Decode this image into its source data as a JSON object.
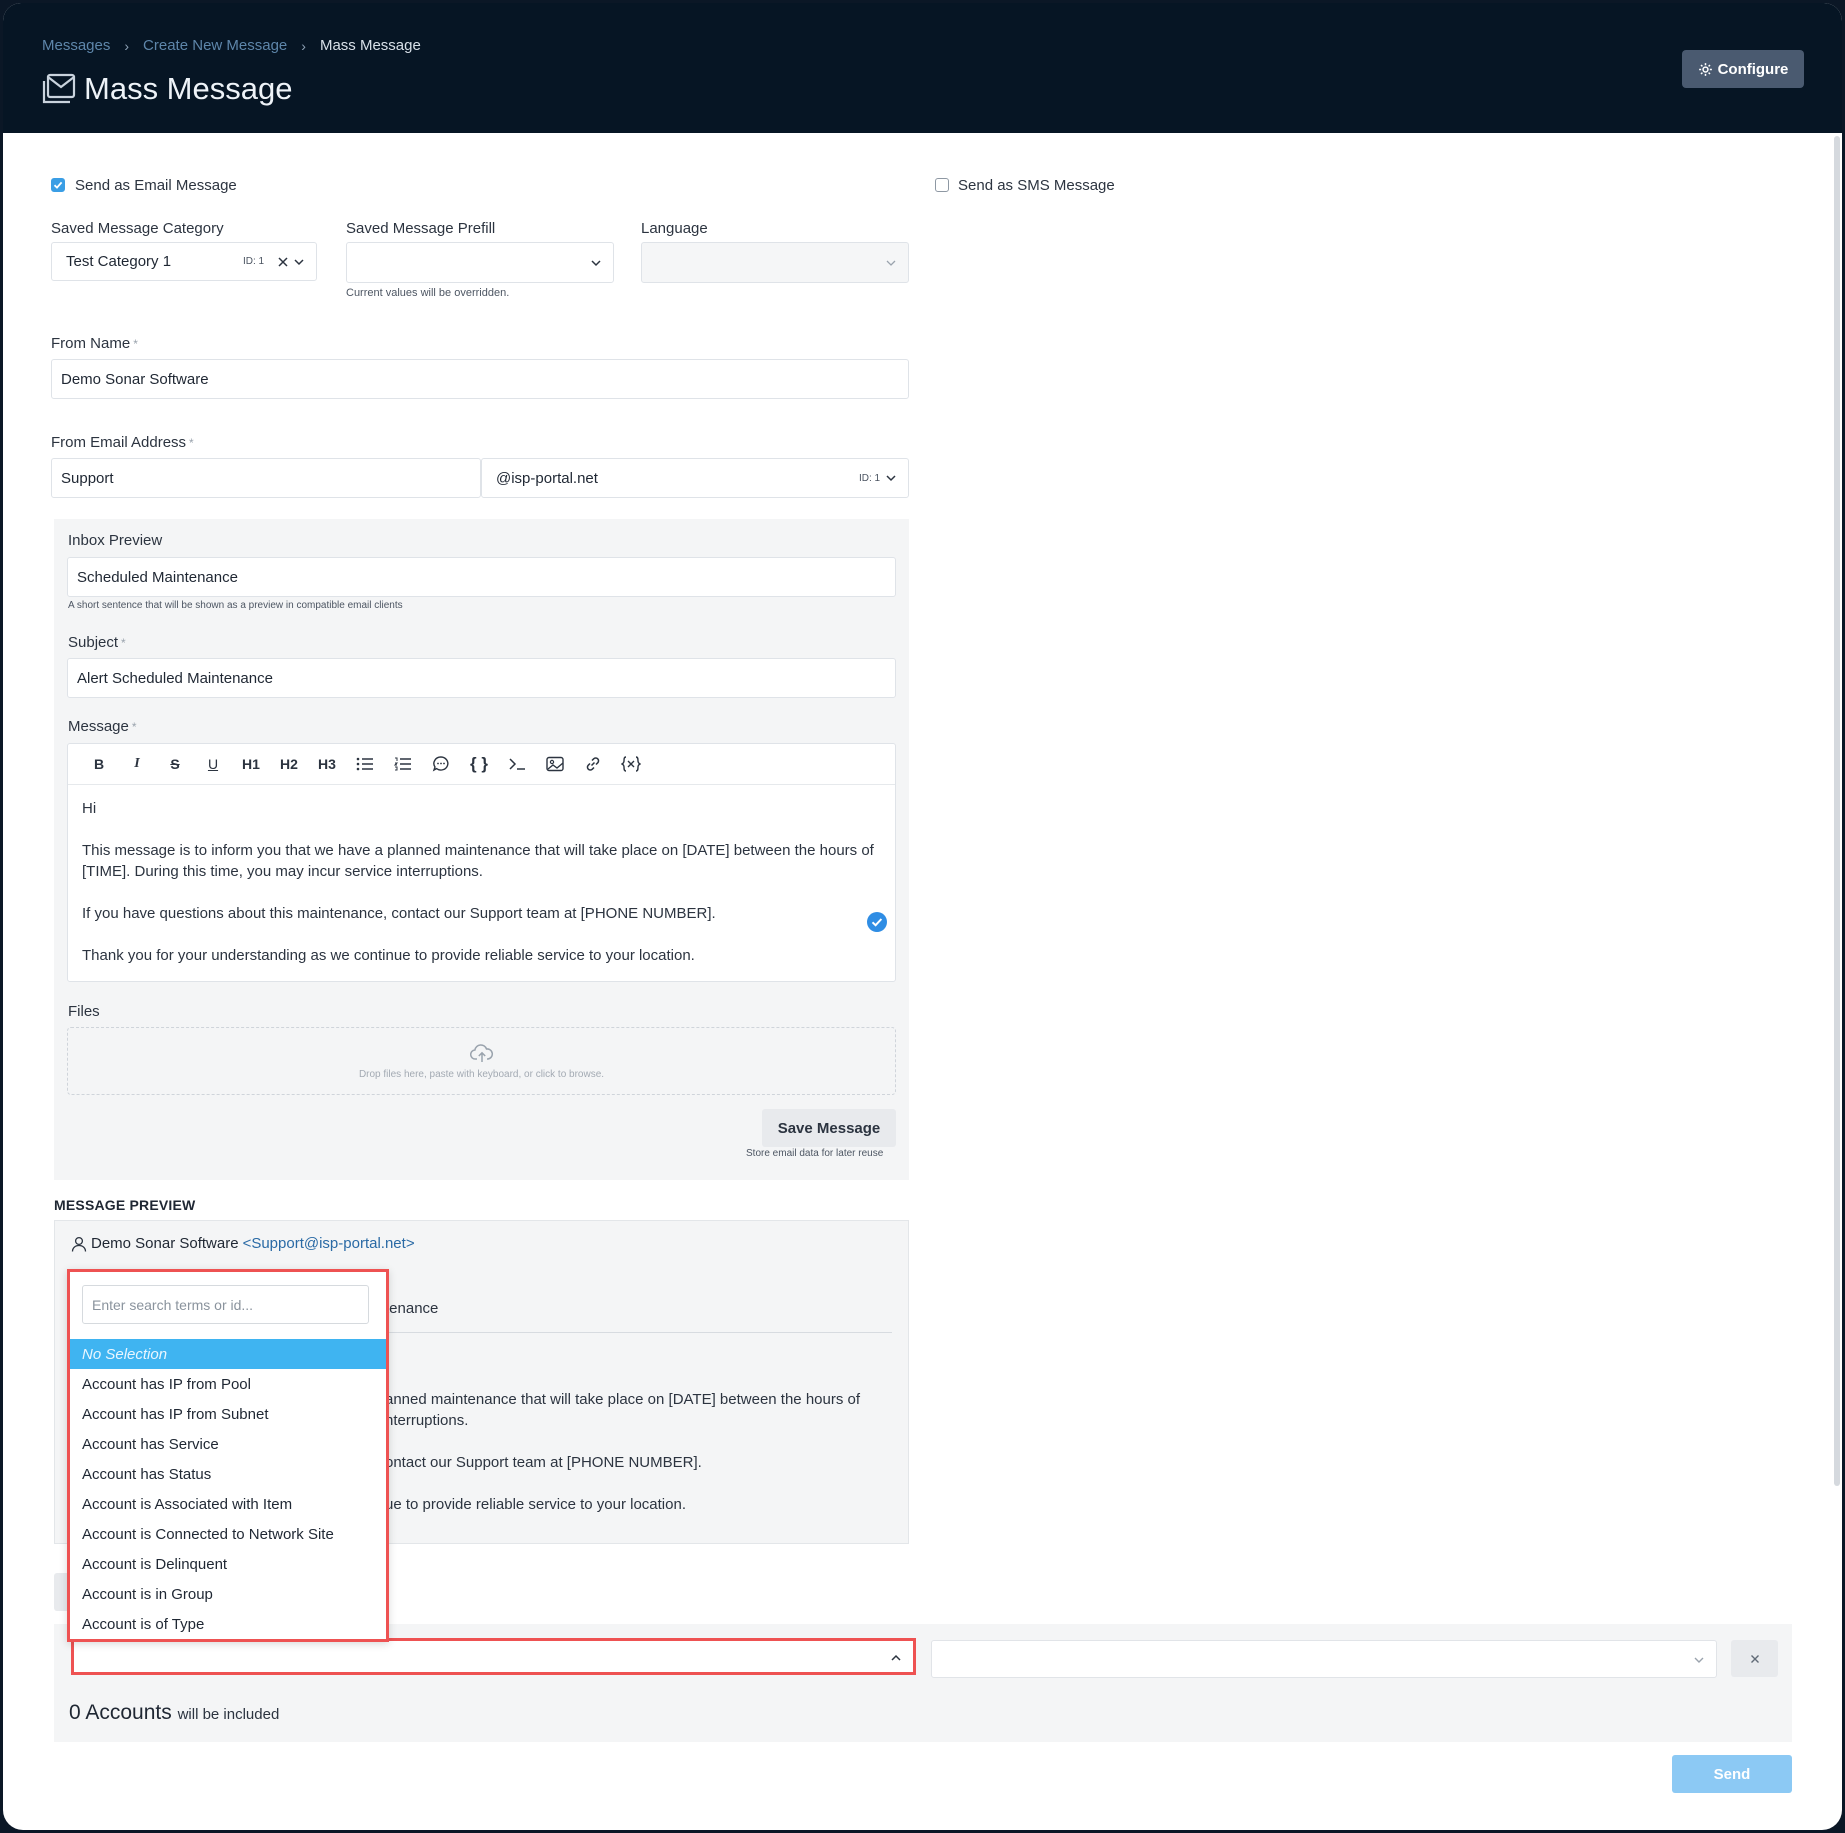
{
  "breadcrumb": [
    "Messages",
    "Create New Message",
    "Mass Message"
  ],
  "page_title": "Mass Message",
  "configure_label": "Configure",
  "send_email_label": "Send as Email Message",
  "send_sms_label": "Send as SMS Message",
  "send_email_checked": true,
  "send_sms_checked": false,
  "category": {
    "label": "Saved Message Category",
    "value": "Test Category 1",
    "id": "ID: 1"
  },
  "prefill": {
    "label": "Saved Message Prefill",
    "value": "",
    "hint": "Current values will be overridden."
  },
  "language": {
    "label": "Language",
    "value": ""
  },
  "from_name": {
    "label": "From Name",
    "required": "*",
    "value": "Demo Sonar Software"
  },
  "from_email": {
    "label": "From Email Address",
    "required": "*",
    "local": "Support",
    "domain": "@isp-portal.net",
    "id": "ID: 1"
  },
  "inbox_preview": {
    "label": "Inbox Preview",
    "value": "Scheduled Maintenance",
    "hint": "A short sentence that will be shown as a preview in compatible email clients"
  },
  "subject": {
    "label": "Subject",
    "required": "*",
    "value": "Alert Scheduled Maintenance"
  },
  "message": {
    "label": "Message",
    "required": "*",
    "toolbar": [
      "B",
      "I",
      "S",
      "U",
      "H1",
      "H2",
      "H3",
      "bullet-list",
      "numbered-list",
      "quote",
      "{ }",
      "code",
      "image",
      "link",
      "variable"
    ],
    "paragraphs": [
      "Hi",
      "This message is to inform you that we have a planned maintenance that will take place on [DATE] between the hours of [TIME]. During this time, you may incur service interruptions.",
      "If you have questions about this maintenance, contact our Support team at [PHONE NUMBER].",
      "Thank you for your understanding as we continue to provide reliable service to your location."
    ]
  },
  "files": {
    "label": "Files",
    "dropzone": "Drop files here, paste with keyboard, or click to browse."
  },
  "save_message": {
    "label": "Save Message",
    "hint": "Store email data for later reuse"
  },
  "preview": {
    "heading": "MESSAGE PREVIEW",
    "from_name": "Demo Sonar Software",
    "from_addr": "<Support@isp-portal.net>",
    "subject_frag": "tenance",
    "lines": [
      "anned maintenance that will take place on [DATE] between the hours of",
      "nterruptions.",
      "ontact our Support team at [PHONE NUMBER].",
      "ue to provide reliable service to your location."
    ]
  },
  "dropdown": {
    "search_placeholder": "Enter search terms or id...",
    "items": [
      "No Selection",
      "Account has IP from Pool",
      "Account has IP from Subnet",
      "Account has Service",
      "Account has Status",
      "Account is Associated with Item",
      "Account is Connected to Network Site",
      "Account is Delinquent",
      "Account is in Group",
      "Account is of Type"
    ],
    "selected_index": 0
  },
  "accounts": {
    "count": "0 Accounts",
    "suffix": "will be included"
  },
  "send_label": "Send",
  "colors": {
    "header": "#061524",
    "accent": "#3a9ee5",
    "highlight": "#ee5252",
    "selected": "#3fb4f1"
  }
}
